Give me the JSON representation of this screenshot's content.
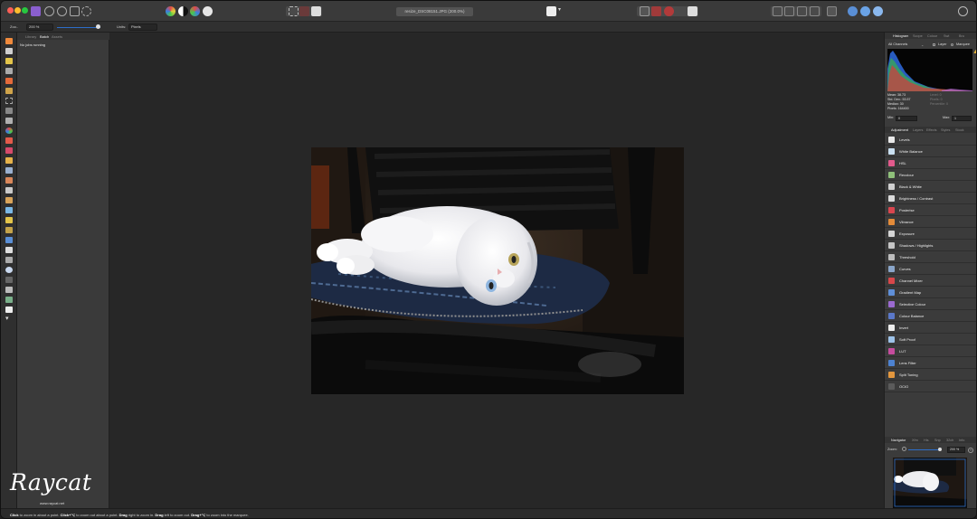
{
  "window": {
    "document_title": "resize_DSC08151.JPG (200.0%)"
  },
  "context_bar": {
    "zoom_label": "Zoo..",
    "zoom_value": "200 %",
    "units_label": "Units:",
    "units_value": "Pixels"
  },
  "left_panel": {
    "tabs": [
      "Library",
      "Batch",
      "Assets"
    ],
    "active_tab": "Batch",
    "status": "No jobs running"
  },
  "right_panel": {
    "top_tabs": [
      "Histogram",
      "Scope",
      "Colour",
      "Swt",
      "Bru"
    ],
    "histogram": {
      "channel": "All Channels",
      "layer_label": "Layer",
      "marquee_label": "Marquee",
      "stats_left": [
        "Mean: 38.73",
        "Std. Dev.: 53.57",
        "Median: 30",
        "Pixels: 164400"
      ],
      "stats_right": [
        "Level: 0",
        "Pixels: 0",
        "Percentile: 0"
      ],
      "min_label": "Min:",
      "min_value": "0",
      "max_label": "Max:",
      "max_value": "1"
    },
    "adjustment_tabs": [
      "Adjustment",
      "Layers",
      "Effects",
      "Styles",
      "Stock"
    ],
    "adjustments": [
      {
        "label": "Levels",
        "color": "#e9e9e9"
      },
      {
        "label": "White Balance",
        "color": "#c9dff0"
      },
      {
        "label": "HSL",
        "color": "#e25a8c"
      },
      {
        "label": "Recolour",
        "color": "#8fc07a"
      },
      {
        "label": "Black & White",
        "color": "#cfcfcf"
      },
      {
        "label": "Brightness / Contrast",
        "color": "#dadada"
      },
      {
        "label": "Posterise",
        "color": "#d9464f"
      },
      {
        "label": "Vibrance",
        "color": "#e38b39"
      },
      {
        "label": "Exposure",
        "color": "#d5d5d5"
      },
      {
        "label": "Shadows / Highlights",
        "color": "#c6c6c6"
      },
      {
        "label": "Threshold",
        "color": "#bdbdbd"
      },
      {
        "label": "Curves",
        "color": "#8aa5c9"
      },
      {
        "label": "Channel Mixer",
        "color": "#d8474a"
      },
      {
        "label": "Gradient Map",
        "color": "#5f8fd8"
      },
      {
        "label": "Selective Colour",
        "color": "#9b6ad0"
      },
      {
        "label": "Colour Balance",
        "color": "#5b78c9"
      },
      {
        "label": "Invert",
        "color": "#ededed"
      },
      {
        "label": "Soft Proof",
        "color": "#9dc2e8"
      },
      {
        "label": "LUT",
        "color": "#c54c9e"
      },
      {
        "label": "Lens Filter",
        "color": "#4d82d0"
      },
      {
        "label": "Split Toning",
        "color": "#e3973e"
      },
      {
        "label": "OCIO",
        "color": "#5b5b5b"
      }
    ],
    "navigator_tabs": [
      "Navigator",
      "Xfm",
      "His",
      "Snp",
      "32ch",
      "Info"
    ],
    "navigator": {
      "zoom_label": "Zoom:",
      "zoom_value": "200 %",
      "plus": "+"
    }
  },
  "statusbar": {
    "hint_1": "Click",
    "hint_1_text": " to zoom in about a point. ",
    "hint_2": "Click+⌥",
    "hint_2_text": " to zoom out about a point. ",
    "hint_3": "Drag",
    "hint_3_text": " right to zoom in. ",
    "hint_4": "Drag",
    "hint_4_text": " left to zoom out. ",
    "hint_5": "Drag+⌥",
    "hint_5_text": " to zoom into the marquee."
  },
  "watermark": {
    "text": "Raycat",
    "subtext": "www.raycat.net"
  },
  "colors": {
    "accent_blue": "#2d6ec9",
    "panel_bg": "#3b3b3b",
    "canvas_bg": "#272727"
  }
}
